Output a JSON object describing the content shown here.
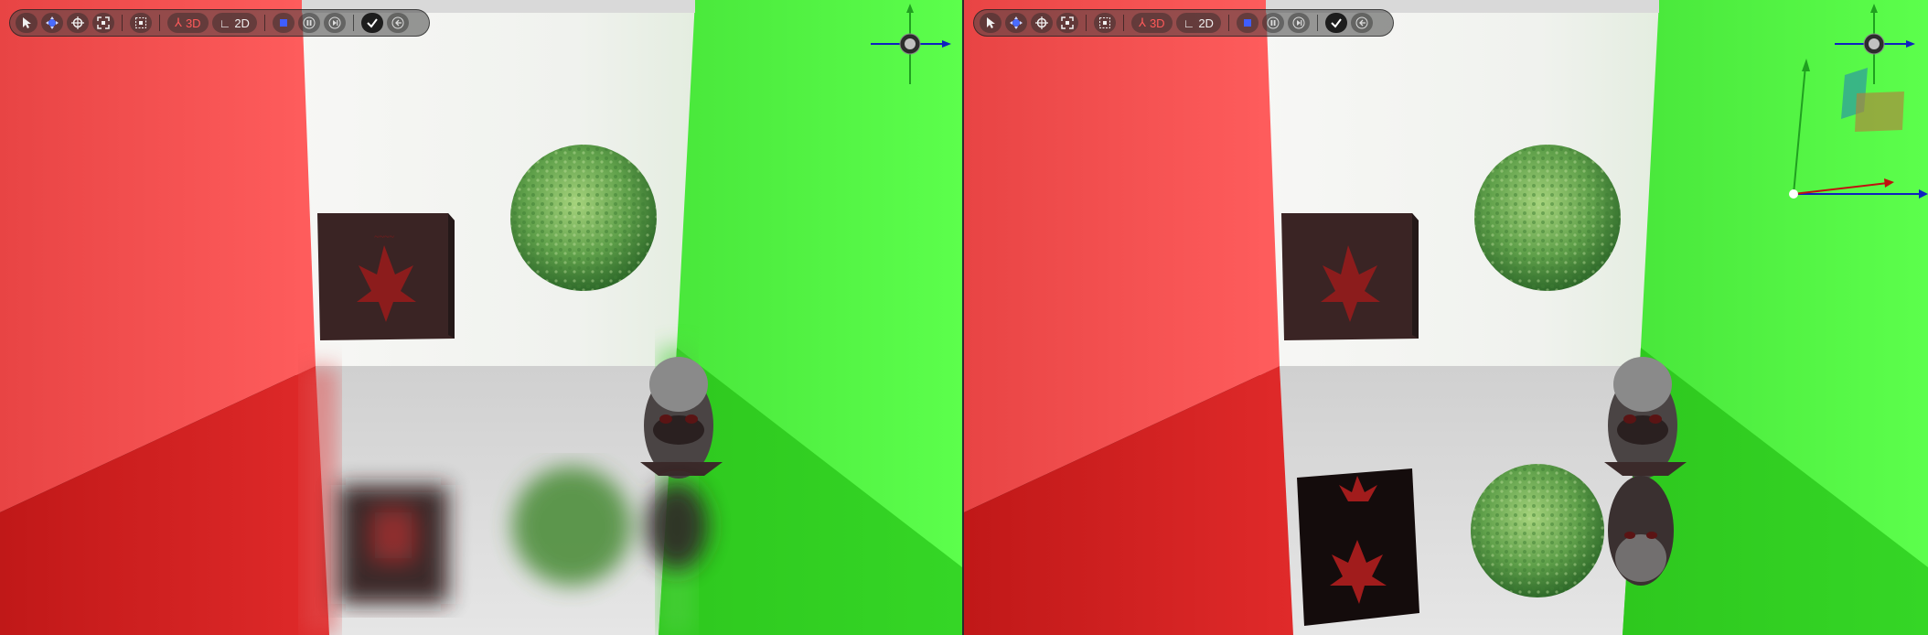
{
  "toolbar": {
    "buttons": [
      {
        "name": "select-tool",
        "icon": "cursor-arrow-icon"
      },
      {
        "name": "move-tool",
        "icon": "move-arrows-icon"
      },
      {
        "name": "rotate-tool",
        "icon": "rotate-crosshair-icon"
      },
      {
        "name": "scale-tool",
        "icon": "scale-frame-icon"
      },
      {
        "name": "grid-snap",
        "icon": "grid-icon"
      }
    ],
    "mode_3d_label": "3D",
    "mode_2d_label": "2D",
    "play_controls": [
      "stop-icon",
      "pause-icon",
      "step-icon"
    ],
    "confirm_icon": "check-icon",
    "back_icon": "back-arrow-icon"
  },
  "colors": {
    "red_wall": "#ff4c4c",
    "green_wall": "#55ff45",
    "back_wall": "#f2f2ef",
    "floor": "#dcdcdc",
    "accent_red": "#ff5a5a",
    "axis_blue": "#1020c0",
    "axis_green": "#20a020",
    "axis_red": "#c01010"
  },
  "viewports": [
    {
      "name": "viewport-left",
      "reflection": "blurred"
    },
    {
      "name": "viewport-right",
      "reflection": "sharp"
    }
  ]
}
